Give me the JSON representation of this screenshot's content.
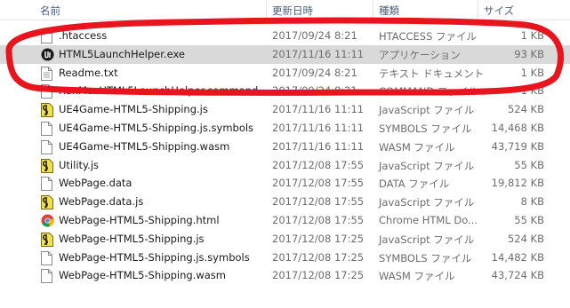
{
  "columns": {
    "name": "名前",
    "date": "更新日時",
    "type": "種類",
    "size": "サイズ"
  },
  "files": [
    {
      "name": ".htaccess",
      "date": "2017/09/24 8:21",
      "type": "HTACCESS ファイル",
      "size": "1 KB",
      "icon": "blank-file-icon"
    },
    {
      "name": "HTML5LaunchHelper.exe",
      "date": "2017/11/16 11:11",
      "type": "アプリケーション",
      "size": "93 KB",
      "icon": "unreal-engine-icon",
      "selected": true
    },
    {
      "name": "Readme.txt",
      "date": "2017/09/24 8:21",
      "type": "テキスト ドキュメント",
      "size": "1 KB",
      "icon": "text-file-icon"
    },
    {
      "name": "RunMacHTML5LaunchHelper.command",
      "date": "2017/09/24 8:21",
      "type": "COMMAND ファイル",
      "size": "1 KB",
      "icon": "blank-file-icon"
    },
    {
      "name": "UE4Game-HTML5-Shipping.js",
      "date": "2017/11/16 11:11",
      "type": "JavaScript ファイル",
      "size": "524 KB",
      "icon": "javascript-file-icon"
    },
    {
      "name": "UE4Game-HTML5-Shipping.js.symbols",
      "date": "2017/11/16 11:11",
      "type": "SYMBOLS ファイル",
      "size": "14,468 KB",
      "icon": "blank-file-icon"
    },
    {
      "name": "UE4Game-HTML5-Shipping.wasm",
      "date": "2017/11/16 11:11",
      "type": "WASM ファイル",
      "size": "43,719 KB",
      "icon": "blank-file-icon"
    },
    {
      "name": "Utility.js",
      "date": "2017/12/08 17:55",
      "type": "JavaScript ファイル",
      "size": "55 KB",
      "icon": "javascript-file-icon"
    },
    {
      "name": "WebPage.data",
      "date": "2017/12/08 17:55",
      "type": "DATA ファイル",
      "size": "19,812 KB",
      "icon": "blank-file-icon"
    },
    {
      "name": "WebPage.data.js",
      "date": "2017/12/08 17:55",
      "type": "JavaScript ファイル",
      "size": "8 KB",
      "icon": "javascript-file-icon"
    },
    {
      "name": "WebPage-HTML5-Shipping.html",
      "date": "2017/12/08 17:55",
      "type": "Chrome HTML Do...",
      "size": "55 KB",
      "icon": "chrome-html-icon"
    },
    {
      "name": "WebPage-HTML5-Shipping.js",
      "date": "2017/12/08 17:25",
      "type": "JavaScript ファイル",
      "size": "524 KB",
      "icon": "javascript-file-icon"
    },
    {
      "name": "WebPage-HTML5-Shipping.js.symbols",
      "date": "2017/12/08 17:25",
      "type": "SYMBOLS ファイル",
      "size": "14,482 KB",
      "icon": "blank-file-icon"
    },
    {
      "name": "WebPage-HTML5-Shipping.wasm",
      "date": "2017/12/08 17:25",
      "type": "WASM ファイル",
      "size": "43,724 KB",
      "icon": "blank-file-icon"
    }
  ],
  "colors": {
    "selected_row": "#d9d9d9",
    "header_text": "#4c607a",
    "annotation": "#e8141e"
  }
}
